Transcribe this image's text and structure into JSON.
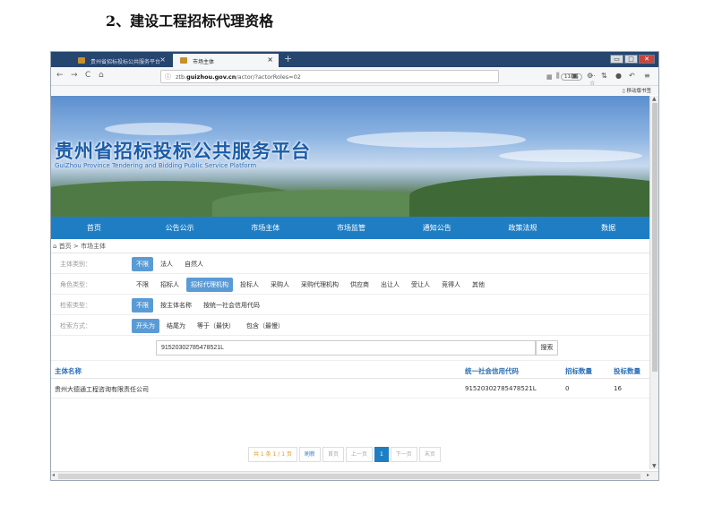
{
  "doc_heading": "2、建设工程招标代理资格",
  "browser": {
    "tabs": [
      {
        "label": "贵州省招标投标公共服务平台"
      },
      {
        "label": "市场主体"
      }
    ],
    "tab_close": "×",
    "new_tab": "+",
    "url_prefix": "ztb.",
    "url_domain": "guizhou.gov.cn",
    "url_path": "/actor/?actorRoles=02",
    "zoom": "110%",
    "mobile_bookmarks": "移动版书签",
    "controls": {
      "min": "▭",
      "max": "□",
      "close": "✕"
    }
  },
  "site": {
    "title": "贵州省招标投标公共服务平台",
    "subtitle": "GuiZhou Province Tendering and Bidding Public Service Platform",
    "menu": [
      "首页",
      "公告公示",
      "市场主体",
      "市场监管",
      "通知公告",
      "政策法规",
      "数据"
    ],
    "breadcrumb": {
      "home": "首页",
      "sep": ">",
      "current": "市场主体"
    }
  },
  "filters": [
    {
      "label": "主体类别：",
      "options": [
        "不限",
        "法人",
        "自然人"
      ],
      "selected": 0
    },
    {
      "label": "角色类型：",
      "options": [
        "不限",
        "招标人",
        "招标代理机构",
        "投标人",
        "采购人",
        "采购代理机构",
        "供应商",
        "出让人",
        "受让人",
        "竞得人",
        "其他"
      ],
      "selected": 2
    },
    {
      "label": "检索类型：",
      "options": [
        "不限",
        "按主体名称",
        "按统一社会信用代码"
      ],
      "selected": 0
    },
    {
      "label": "检索方式：",
      "options": [
        "开头为",
        "结尾为",
        "等于（最快）",
        "包含（最慢）"
      ],
      "selected": 0
    }
  ],
  "search": {
    "value": "91520302785478521L",
    "button": "搜索"
  },
  "table": {
    "headers": [
      "主体名称",
      "统一社会信用代码",
      "招标数量",
      "投标数量"
    ],
    "rows": [
      [
        "贵州大德通工程咨询有限责任公司",
        "91520302785478521L",
        "0",
        "16"
      ]
    ]
  },
  "pager": {
    "info": "共 1 条 1 / 1 页",
    "refresh": "刷新",
    "first": "首页",
    "prev": "上一页",
    "current": "1",
    "next": "下一页",
    "last": "末页"
  }
}
